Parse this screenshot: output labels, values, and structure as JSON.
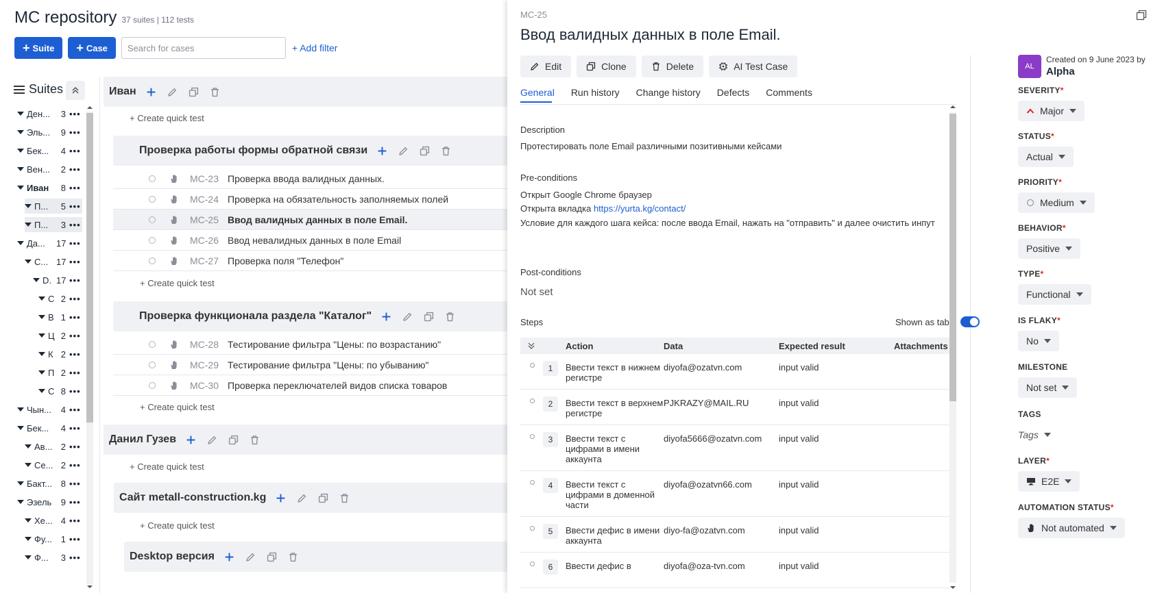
{
  "repo": {
    "title": "MC repository",
    "meta": "37 suites | 112 tests",
    "suite_button": "Suite",
    "case_button": "Case",
    "search_placeholder": "Search for cases",
    "add_filter": "+ Add filter",
    "suites_title": "Suites"
  },
  "tree": [
    {
      "name": "Ден...",
      "count": "3",
      "bold": false
    },
    {
      "name": "Эль...",
      "count": "9",
      "bold": false
    },
    {
      "name": "Бек...",
      "count": "4",
      "bold": false
    },
    {
      "name": "Вен...",
      "count": "2",
      "bold": false
    },
    {
      "name": "Иван",
      "count": "8",
      "bold": true
    },
    {
      "name": "П...",
      "count": "5",
      "bold": false
    },
    {
      "name": "П...",
      "count": "3",
      "bold": false
    },
    {
      "name": "Да...",
      "count": "17",
      "bold": false
    },
    {
      "name": "С...",
      "count": "17",
      "bold": false
    },
    {
      "name": "D.",
      "count": "17",
      "bold": false
    },
    {
      "name": "С",
      "count": "2",
      "bold": false
    },
    {
      "name": "В",
      "count": "1",
      "bold": false
    },
    {
      "name": "Ц",
      "count": "2",
      "bold": false
    },
    {
      "name": "К",
      "count": "2",
      "bold": false
    },
    {
      "name": "П",
      "count": "2",
      "bold": false
    },
    {
      "name": "С",
      "count": "8",
      "bold": false
    },
    {
      "name": "Чын...",
      "count": "4",
      "bold": false
    },
    {
      "name": "Бек...",
      "count": "4",
      "bold": false
    },
    {
      "name": "Ав...",
      "count": "2",
      "bold": false
    },
    {
      "name": "Се...",
      "count": "2",
      "bold": false
    },
    {
      "name": "Бакт...",
      "count": "8",
      "bold": false
    },
    {
      "name": "Эзель",
      "count": "9",
      "bold": false
    },
    {
      "name": "Хе...",
      "count": "4",
      "bold": false
    },
    {
      "name": "Фу...",
      "count": "1",
      "bold": false
    },
    {
      "name": "Ф...",
      "count": "3",
      "bold": false
    }
  ],
  "tree_dots": "•••",
  "suites": {
    "ivan": "Иван",
    "feedback": "Проверка работы формы обратной связи",
    "catalog": "Проверка функционала раздела \"Каталог\"",
    "danil": "Данил Гузев",
    "metall": "Сайт metall-construction.kg",
    "desktop": "Desktop версия"
  },
  "quick_test": "+ Create quick test",
  "cases_feedback": [
    {
      "id": "MC-23",
      "title": "Проверка ввода валидных данных."
    },
    {
      "id": "MC-24",
      "title": "Проверка на обязательность заполняемых полей"
    },
    {
      "id": "MC-25",
      "title": "Ввод валидных данных в поле Email."
    },
    {
      "id": "MC-26",
      "title": "Ввод невалидных данных в поле Email"
    },
    {
      "id": "MC-27",
      "title": "Проверка поля \"Телефон\""
    }
  ],
  "cases_catalog": [
    {
      "id": "MC-28",
      "title": "Тестирование фильтра \"Цены: по возрастанию\""
    },
    {
      "id": "MC-29",
      "title": "Тестирование фильтра \"Цены: по убыванию\""
    },
    {
      "id": "MC-30",
      "title": "Проверка переключателей видов списка товаров"
    }
  ],
  "detail": {
    "id": "MC-25",
    "title": "Ввод валидных данных в поле Email.",
    "actions": {
      "edit": "Edit",
      "clone": "Clone",
      "delete": "Delete",
      "ai": "AI Test Case"
    },
    "tabs": {
      "general": "General",
      "run_history": "Run history",
      "change_history": "Change history",
      "defects": "Defects",
      "comments": "Comments"
    },
    "description_label": "Description",
    "description": "Протестировать поле Email различными позитивными кейсами",
    "preconditions_label": "Pre-conditions",
    "pre1": "Открыт Google Chrome браузер",
    "pre2_prefix": "Открыта вкладка ",
    "pre2_link": "https://yurta.kg/contact/",
    "pre3": "Условие для каждого шага кейса: после ввода Email, нажать на \"отправить\" и далее очистить инпут",
    "postconditions_label": "Post-conditions",
    "postconditions": "Not set",
    "steps_label": "Steps",
    "shown_as_table": "Shown as table",
    "columns": {
      "action": "Action",
      "data": "Data",
      "expected": "Expected result",
      "attachments": "Attachments"
    },
    "steps": [
      {
        "n": "1",
        "action": "Ввести текст в нижнем регистре",
        "data": "diyofa@ozatvn.com",
        "expected": "input valid"
      },
      {
        "n": "2",
        "action": "Ввести текст в верхнем регистре",
        "data": "PJKRAZY@MAIL.RU",
        "expected": "input valid"
      },
      {
        "n": "3",
        "action": "Ввести текст с цифрами в имени аккаунта",
        "data": "diyofa5666@ozatvn.com",
        "expected": "input valid"
      },
      {
        "n": "4",
        "action": "Ввести текст с цифрами в доменной части",
        "data": "diyofa@ozatvn66.com",
        "expected": "input valid"
      },
      {
        "n": "5",
        "action": "Ввести дефис в имени аккаунта",
        "data": "diyo-fa@ozatvn.com",
        "expected": "input valid"
      },
      {
        "n": "6",
        "action": "Ввести дефис в",
        "data": "diyofa@oza-tvn.com",
        "expected": "input valid"
      }
    ]
  },
  "props": {
    "avatar": "AL",
    "created_on": "Created on 9 June 2023 by",
    "author": "Alpha",
    "severity_label": "SEVERITY",
    "severity": "Major",
    "status_label": "STATUS",
    "status": "Actual",
    "priority_label": "PRIORITY",
    "priority": "Medium",
    "behavior_label": "BEHAVIOR",
    "behavior": "Positive",
    "type_label": "TYPE",
    "type": "Functional",
    "flaky_label": "IS FLAKY",
    "flaky": "No",
    "milestone_label": "MILESTONE",
    "milestone": "Not set",
    "tags_label": "TAGS",
    "tags": "Tags",
    "layer_label": "LAYER",
    "layer": "E2E",
    "automation_label": "AUTOMATION STATUS",
    "automation": "Not automated"
  },
  "colors": {
    "accent": "#1d5fd3",
    "required": "#dc2626",
    "severity_major": "#dc2626",
    "avatar_bg": "#8a3cc8"
  }
}
